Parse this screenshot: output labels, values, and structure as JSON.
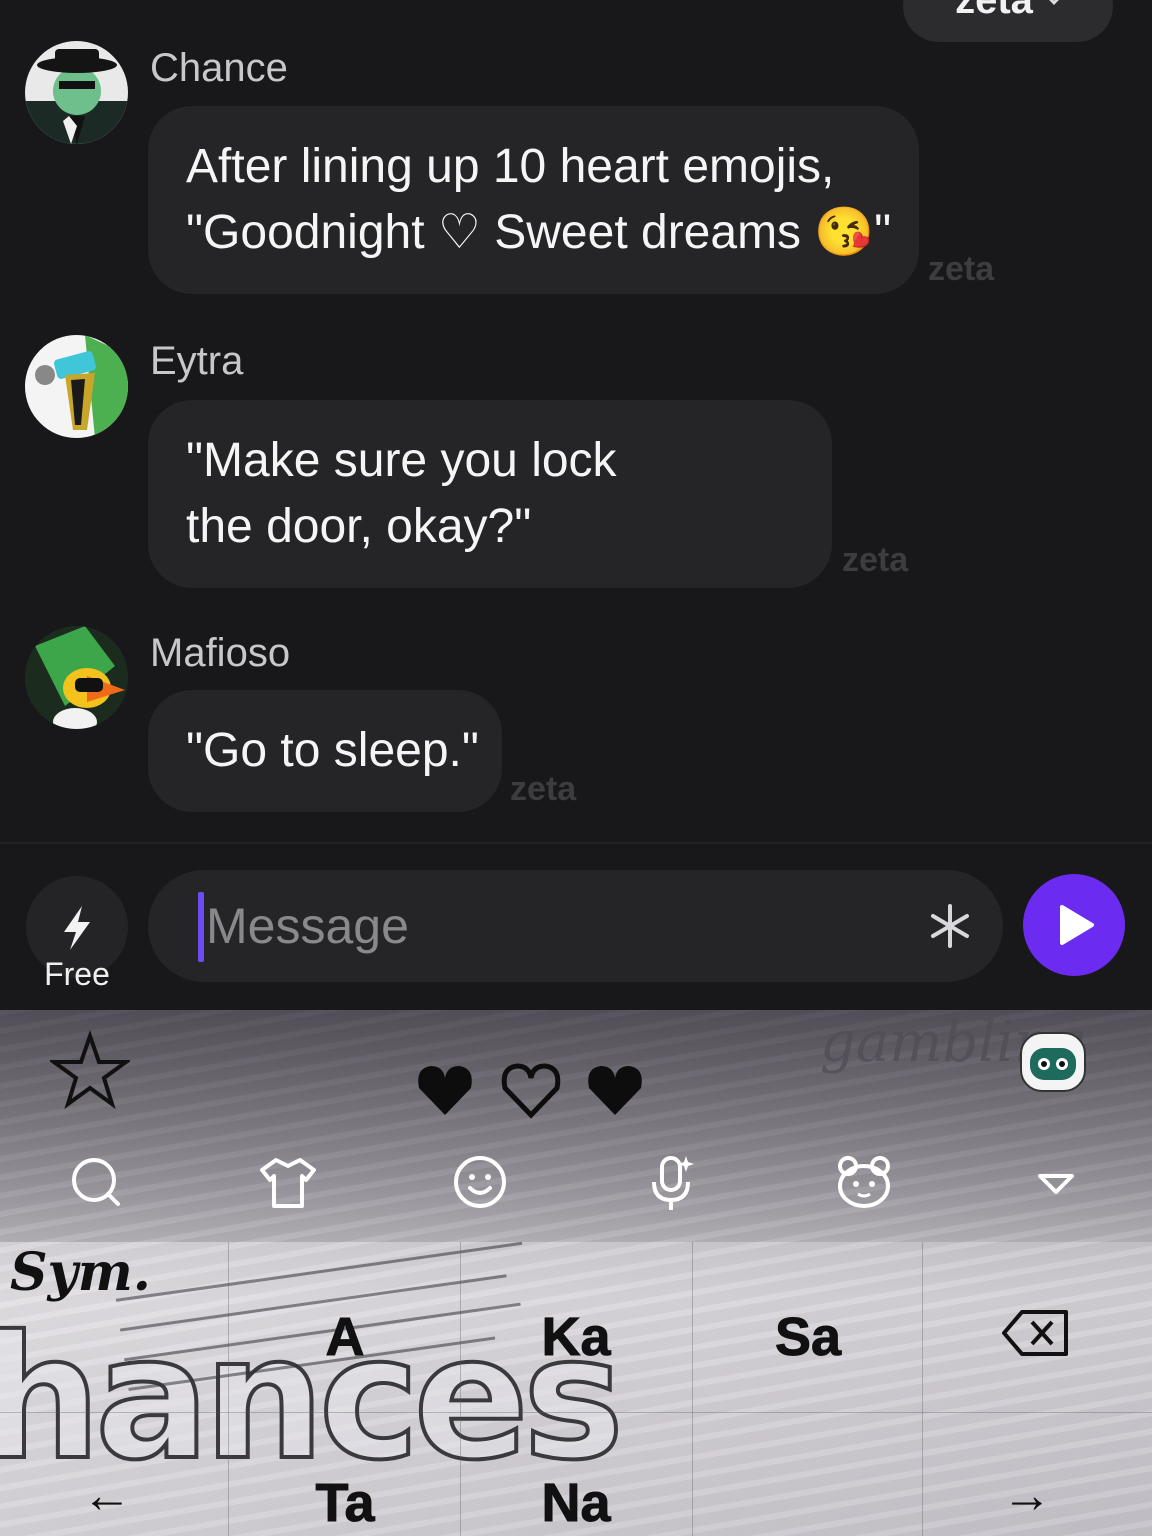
{
  "header": {
    "model_label": "zeta"
  },
  "messages": [
    {
      "sender": "Chance",
      "lines": [
        "After lining up 10 heart emojis,",
        "\"Goodnight ♡ Sweet dreams 😘\""
      ],
      "watermark": "zeta"
    },
    {
      "sender": "Eytra",
      "lines": [
        "\"Make sure you lock",
        "the door, okay?\""
      ],
      "watermark": "zeta"
    },
    {
      "sender": "Mafioso",
      "lines": [
        "\"Go to sleep.\""
      ],
      "watermark": "zeta"
    }
  ],
  "composer": {
    "free_label": "Free",
    "placeholder": "Message",
    "value": ""
  },
  "keyboard": {
    "theme_text": "gambling",
    "symbol_key": "Sym.",
    "row1": [
      "A",
      "Ka",
      "Sa"
    ],
    "row2": [
      "Ta",
      "Na"
    ],
    "left_arrow": "←",
    "right_arrow": "→",
    "toolbar_icons": [
      "search-icon",
      "theme-shirt-icon",
      "emoji-icon",
      "voice-input-icon",
      "sticker-bear-icon",
      "collapse-keyboard-icon"
    ]
  },
  "colors": {
    "background": "#18181a",
    "bubble": "#252528",
    "send_button": "#6c2bf0",
    "caret": "#6c4cf5"
  }
}
